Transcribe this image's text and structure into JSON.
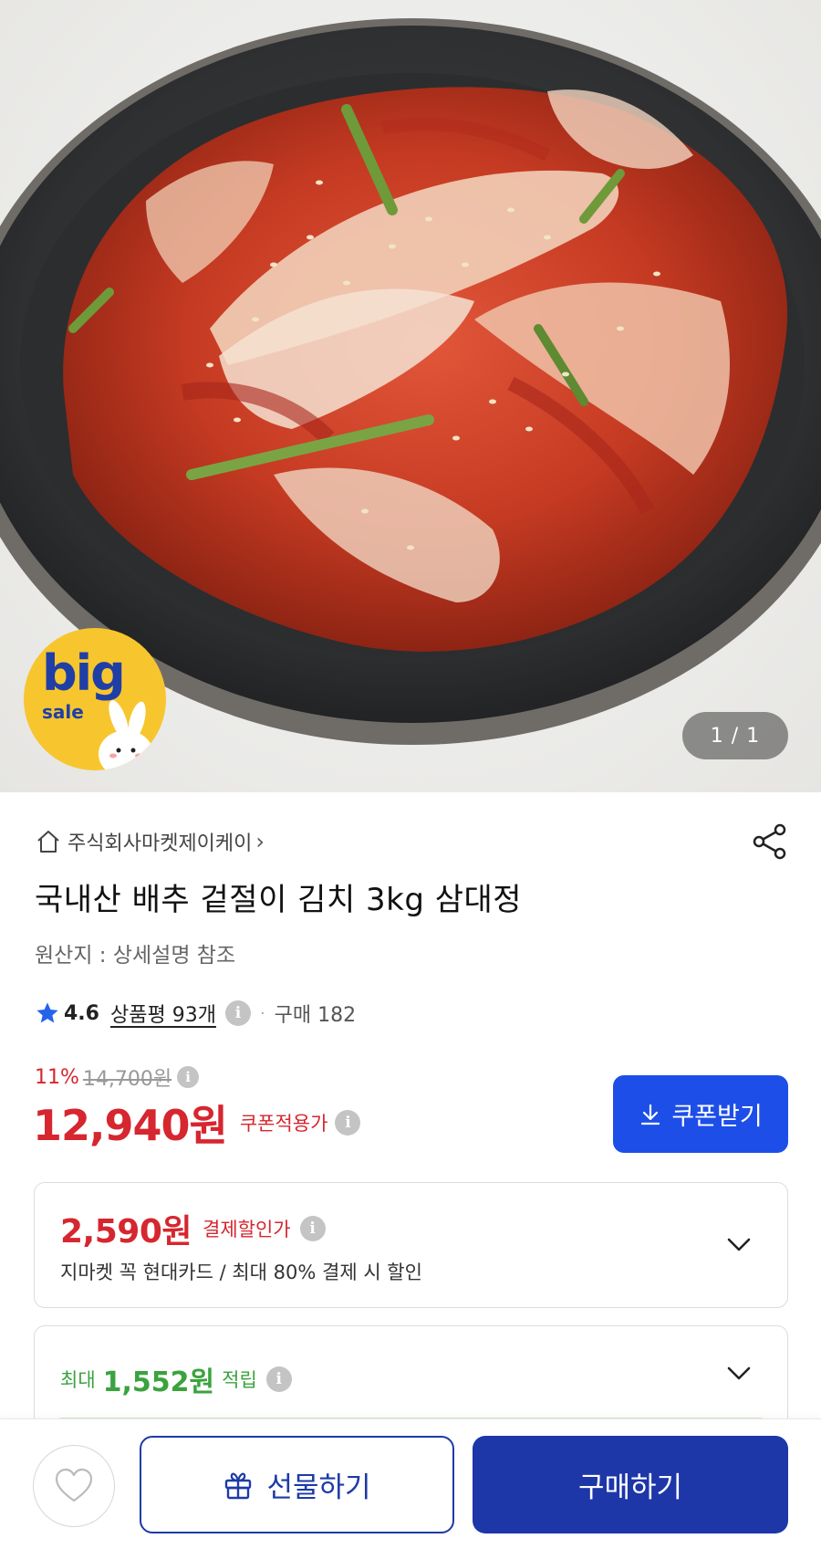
{
  "hero": {
    "badge_big": "big",
    "badge_sale": "sale",
    "counter": "1 / 1"
  },
  "product": {
    "seller": "주식회사마켓제이케이",
    "title": "국내산 배추 겉절이 김치 3kg 삼대정",
    "origin": "원산지 : 상세설명 참조",
    "rating": "4.6",
    "review_link": "상품평 93개",
    "purchase_count": "구매 182"
  },
  "pricing": {
    "discount_percent": "11%",
    "original_price": "14,700원",
    "price": "12,940원",
    "price_note": "쿠폰적용가",
    "coupon_button": "쿠폰받기"
  },
  "payment_card": {
    "amount": "2,590원",
    "label": "결제할인가",
    "description": "지마켓 꼭 현대카드 / 최대 80% 결제 시 할인"
  },
  "points_card": {
    "prefix": "최대",
    "amount": "1,552원",
    "suffix": "적립"
  },
  "bottom_bar": {
    "gift_label": "선물하기",
    "buy_label": "구매하기"
  },
  "colors": {
    "accent_red": "#d6262f",
    "accent_blue": "#1d4ee8",
    "buy_navy": "#1d36a8",
    "points_green": "#3aa33c"
  }
}
